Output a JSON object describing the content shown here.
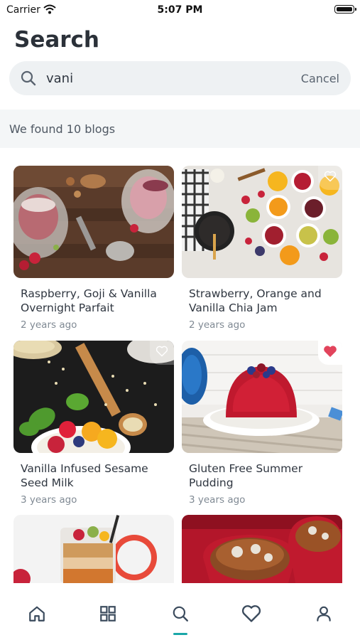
{
  "status": {
    "carrier": "Carrier",
    "time": "5:07 PM"
  },
  "page": {
    "title": "Search"
  },
  "search": {
    "value": "vani",
    "cancel_label": "Cancel"
  },
  "results": {
    "summary": "We found 10 blogs"
  },
  "cards": [
    {
      "title": "Raspberry, Goji & Vanilla Overnight Parfait",
      "age": "2 years ago",
      "favorite": false
    },
    {
      "title": "Strawberry, Orange and Vanilla Chia Jam",
      "age": "2 years ago",
      "favorite": false
    },
    {
      "title": "Vanilla Infused Sesame Seed Milk",
      "age": "3 years ago",
      "favorite": false
    },
    {
      "title": "Gluten Free Summer Pudding",
      "age": "3 years ago",
      "favorite": true
    },
    {
      "title": "",
      "age": "",
      "favorite": false
    },
    {
      "title": "",
      "age": "",
      "favorite": false
    }
  ],
  "tabs": [
    {
      "icon": "home-icon"
    },
    {
      "icon": "grid-icon"
    },
    {
      "icon": "search-icon",
      "active": true
    },
    {
      "icon": "heart-icon"
    },
    {
      "icon": "user-icon"
    }
  ],
  "colors": {
    "accent": "#1aa7a8",
    "favorite": "#e2445c",
    "text": "#2f3640",
    "muted": "#808a94"
  }
}
